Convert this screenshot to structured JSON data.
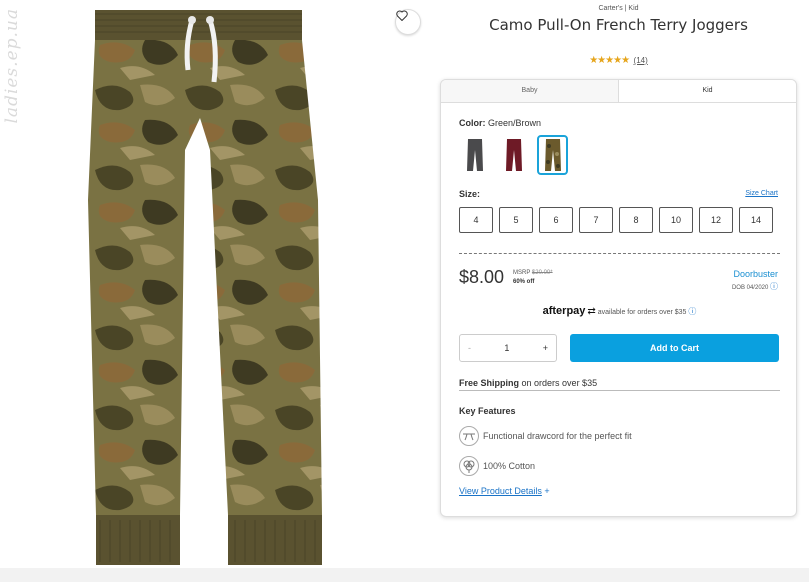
{
  "watermark": "ladies.ep.ua",
  "product": {
    "brand": "Carter's | Kid",
    "title": "Camo Pull-On French Terry Joggers",
    "stars": "★★★★★",
    "review_count": "(14)"
  },
  "tabs": [
    {
      "label": "Baby",
      "active": false
    },
    {
      "label": "Kid",
      "active": true
    }
  ],
  "color": {
    "label": "Color:",
    "value": "Green/Brown",
    "swatches": [
      {
        "name": "Grey",
        "color": "#4a4a4c",
        "selected": false
      },
      {
        "name": "Burgundy",
        "color": "#6e1a26",
        "selected": false
      },
      {
        "name": "Green/Brown",
        "color": "#6b5a2c",
        "selected": true
      }
    ]
  },
  "size": {
    "label": "Size:",
    "chart_link": "Size Chart",
    "options": [
      "4",
      "5",
      "6",
      "7",
      "8",
      "10",
      "12",
      "14"
    ]
  },
  "pricing": {
    "price": "$8.00",
    "msrp_label": "MSRP",
    "msrp_value": "$20.00*",
    "discount": "60% off",
    "badge": "Doorbuster",
    "badge_sub": "DOB 04/2020"
  },
  "afterpay": {
    "logo": "afterpay",
    "text": "available for orders over $35"
  },
  "cart": {
    "minus": "-",
    "quantity": "1",
    "plus": "+",
    "add_label": "Add to Cart"
  },
  "shipping": {
    "bold": "Free Shipping",
    "rest": "on orders over $35"
  },
  "features": {
    "title": "Key Features",
    "items": [
      {
        "icon": "drawcord-icon",
        "text": "Functional drawcord for the perfect fit"
      },
      {
        "icon": "cotton-icon",
        "text": "100% Cotton"
      }
    ],
    "details_link": "View Product Details",
    "details_plus": "+"
  },
  "colors": {
    "accent": "#0aa0df",
    "link": "#1a73c7",
    "star": "#e6a51c"
  }
}
